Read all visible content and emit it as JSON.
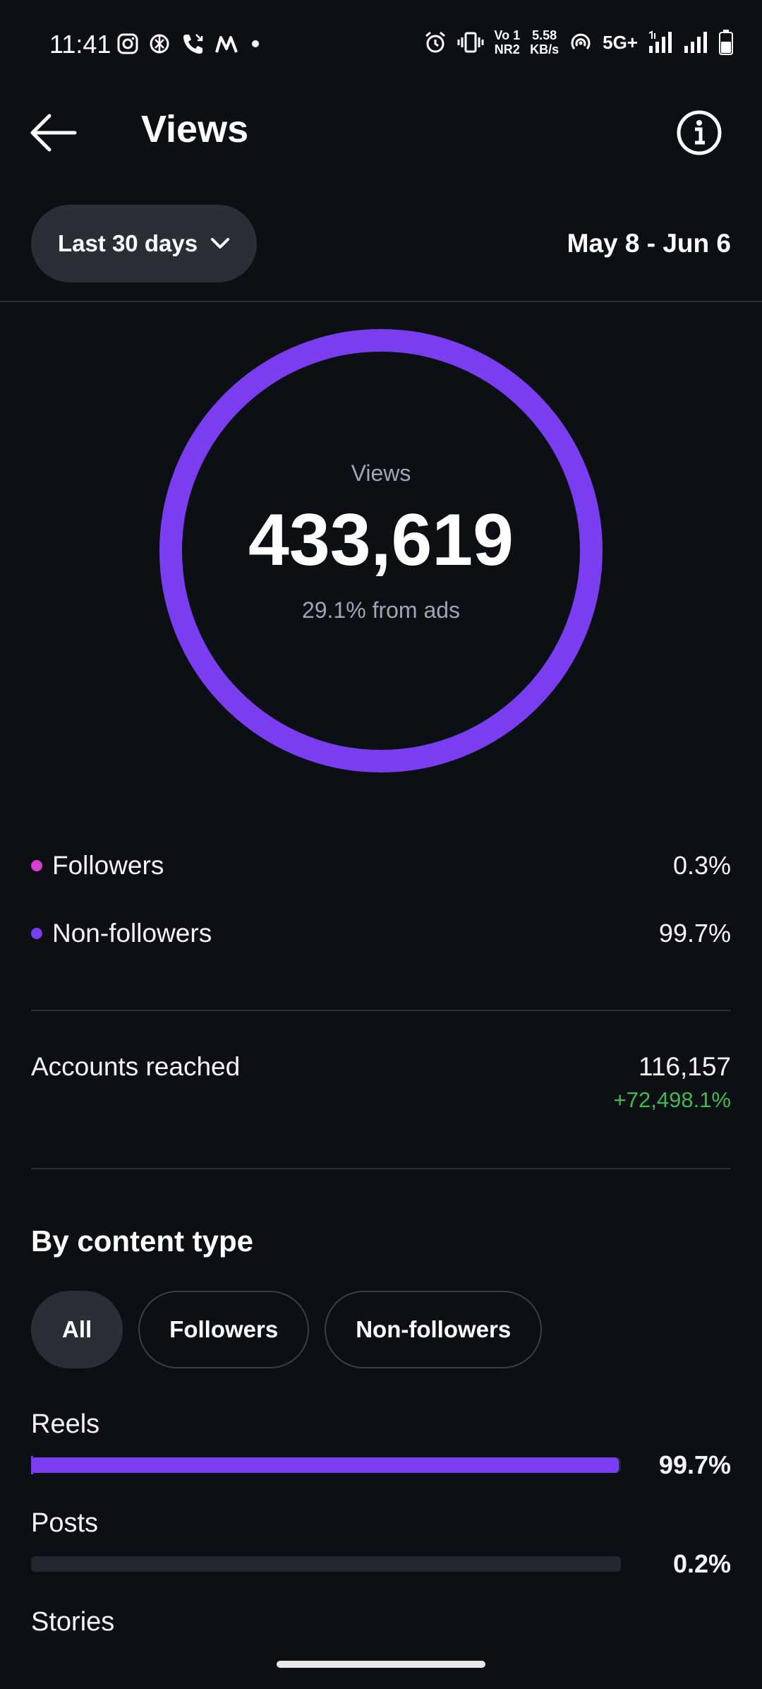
{
  "status_bar": {
    "time": "11:41",
    "left_icons": [
      "instagram-icon",
      "chatgpt-icon",
      "call-icon",
      "app-m-icon",
      "dot-icon"
    ],
    "volte": "Vo 1",
    "nr": "NR2",
    "speed_value": "5.58",
    "speed_unit": "KB/s",
    "network": "5G+"
  },
  "header": {
    "title": "Views"
  },
  "filter": {
    "range_label": "Last 30 days",
    "date_range": "May 8 - Jun 6"
  },
  "summary": {
    "label": "Views",
    "value": "433,619",
    "sub": "29.1% from ads",
    "ring_color": "#7a3ef0"
  },
  "breakdown": [
    {
      "label": "Followers",
      "value": "0.3%",
      "color": "#d63fd1"
    },
    {
      "label": "Non-followers",
      "value": "99.7%",
      "color": "#7a3ef0"
    }
  ],
  "reach": {
    "label": "Accounts reached",
    "value": "116,157",
    "delta": "+72,498.1%"
  },
  "content_type": {
    "title": "By content type",
    "chips": [
      {
        "label": "All",
        "active": true
      },
      {
        "label": "Followers",
        "active": false
      },
      {
        "label": "Non-followers",
        "active": false
      }
    ],
    "rows": [
      {
        "label": "Reels",
        "value": "99.7%",
        "fraction": 0.997
      },
      {
        "label": "Posts",
        "value": "0.2%",
        "fraction": 0.002
      },
      {
        "label": "Stories"
      }
    ]
  },
  "colors": {
    "background": "#0c0f14",
    "accent": "#7a3ef0",
    "positive": "#3fb950"
  }
}
